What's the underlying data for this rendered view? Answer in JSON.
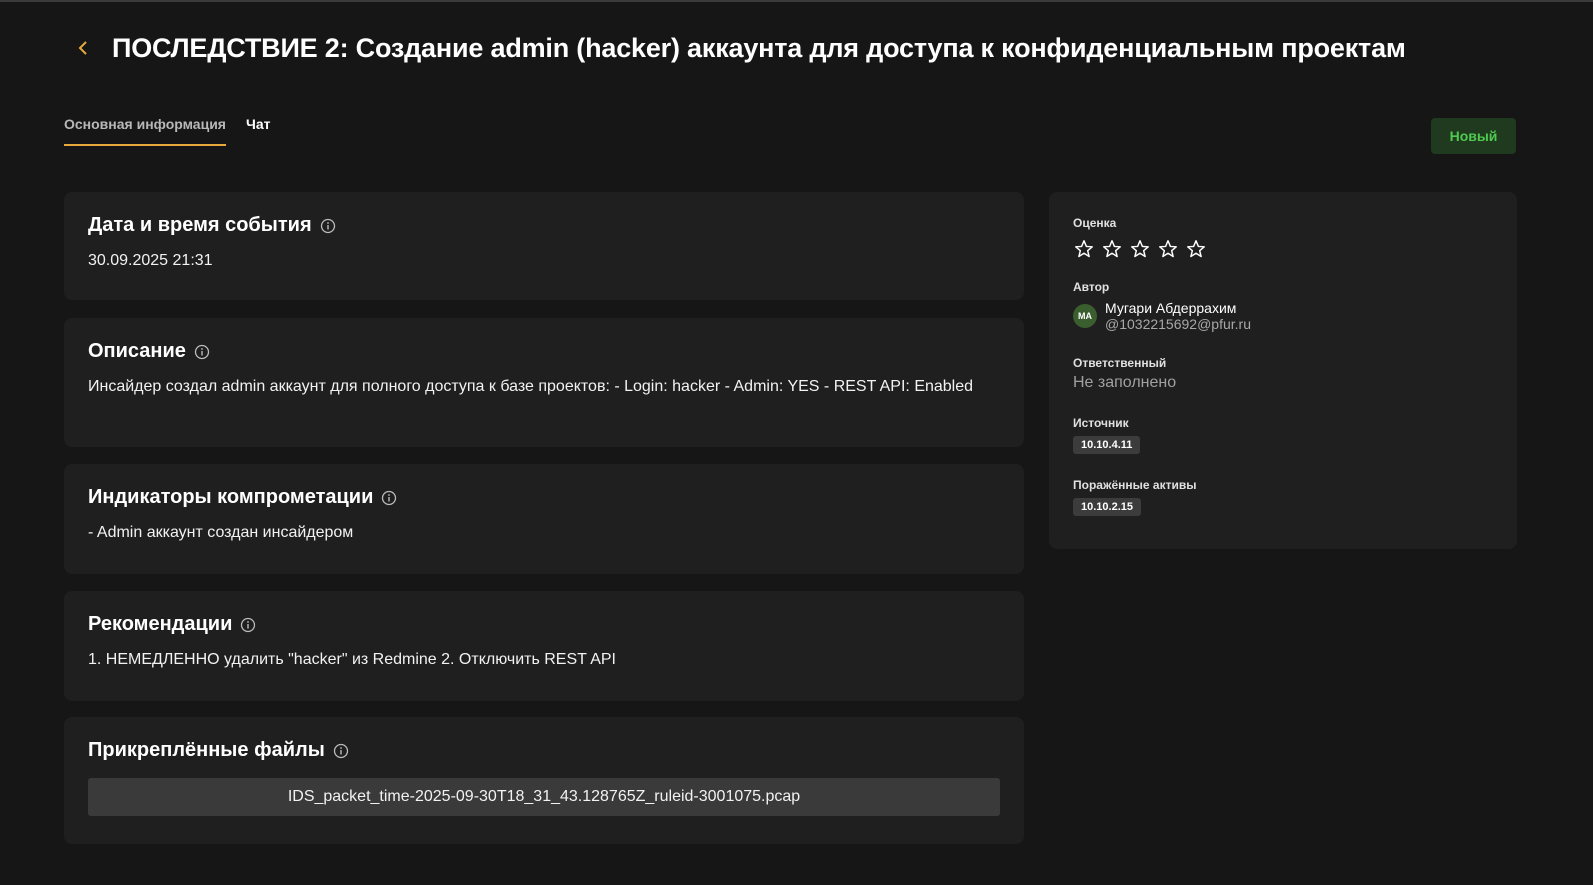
{
  "header": {
    "title": "ПОСЛЕДСТВИЕ 2: Создание admin (hacker) аккаунта для доступа к конфиденциальным проектам",
    "back_icon": "chevron-left-icon",
    "accent": "#e6a93a"
  },
  "tabs": [
    {
      "label": "Основная информация",
      "active": true
    },
    {
      "label": "Чат",
      "active": false
    }
  ],
  "status": {
    "label": "Новый",
    "color": "#4fc94f"
  },
  "sections": {
    "datetime": {
      "title": "Дата и время события",
      "value": "30.09.2025 21:31"
    },
    "description": {
      "title": "Описание",
      "value": "Инсайдер создал admin аккаунт для полного доступа к базе проектов: - Login: hacker - Admin: YES - REST API: Enabled"
    },
    "indicators": {
      "title": "Индикаторы компрометации",
      "value": "- Admin аккаунт создан инсайдером"
    },
    "recommendations": {
      "title": "Рекомендации",
      "value": "1. НЕМЕДЛЕННО удалить \"hacker\" из Redmine 2. Отключить REST API"
    },
    "attachments": {
      "title": "Прикреплённые файлы",
      "files": [
        "IDS_packet_time-2025-09-30T18_31_43.128765Z_ruleid-3001075.pcap"
      ]
    }
  },
  "sidebar": {
    "rating": {
      "label": "Оценка",
      "value": 0,
      "max": 5
    },
    "author": {
      "label": "Автор",
      "initials": "МА",
      "name": "Мугари Абдеррахим",
      "email": "@1032215692@pfur.ru"
    },
    "assignee": {
      "label": "Ответственный",
      "value": "Не заполнено"
    },
    "source": {
      "label": "Источник",
      "value": "10.10.4.11"
    },
    "assets": {
      "label": "Поражённые активы",
      "values": [
        "10.10.2.15"
      ]
    }
  }
}
